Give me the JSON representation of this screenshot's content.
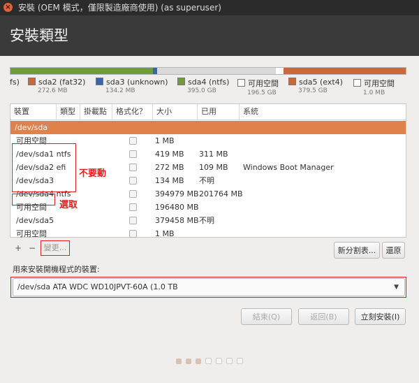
{
  "window": {
    "title": "安裝 (OEM 模式，僅限製造廠商使用) (as superuser)",
    "close_glyph": "×"
  },
  "page": {
    "heading": "安裝類型"
  },
  "partition_bar": {
    "segments": [
      {
        "name": "sda1",
        "color": "#6f9c3a",
        "fraction": 0.36
      },
      {
        "name": "sda3",
        "color": "#3a66a6",
        "fraction": 0.01
      },
      {
        "name": "sda4",
        "color": "#d9d9d9",
        "fraction": 0.3
      },
      {
        "name": "free",
        "color": "#ffffff",
        "fraction": 0.02
      },
      {
        "name": "sda5",
        "color": "#c9683b",
        "fraction": 0.31
      }
    ]
  },
  "legend": [
    {
      "label": "fs)",
      "size": "",
      "color": ""
    },
    {
      "label": "sda2 (fat32)",
      "size": "272.6 MB",
      "color": "#c9683b"
    },
    {
      "label": "sda3 (unknown)",
      "size": "134.2 MB",
      "color": "#3a66a6"
    },
    {
      "label": "sda4 (ntfs)",
      "size": "395.0 GB",
      "color": "#6f9c3a"
    },
    {
      "label": "可用空間",
      "size": "196.5 GB",
      "color": "#ffffff"
    },
    {
      "label": "sda5 (ext4)",
      "size": "379.5 GB",
      "color": "#c9683b"
    },
    {
      "label": "可用空間",
      "size": "1.0 MB",
      "color": "#ffffff"
    }
  ],
  "table": {
    "columns": [
      "裝置",
      "類型",
      "掛載點",
      "格式化？",
      "大小",
      "已用",
      "系統"
    ],
    "group_label": "/dev/sda",
    "rows": [
      {
        "device": "可用空間",
        "size": "1 MB",
        "used": "",
        "system": ""
      },
      {
        "device": "/dev/sda1 ntfs",
        "size": "419 MB",
        "used": "311 MB",
        "system": ""
      },
      {
        "device": "/dev/sda2 efi",
        "size": "272 MB",
        "used": "109 MB",
        "system": "Windows Boot Manager"
      },
      {
        "device": "/dev/sda3",
        "size": "134 MB",
        "used": "不明",
        "system": ""
      },
      {
        "device": "/dev/sda4 ntfs",
        "size": "394979 MB",
        "used": "201764 MB",
        "system": ""
      },
      {
        "device": "可用空間",
        "size": "196480 MB",
        "used": "",
        "system": ""
      },
      {
        "device": "/dev/sda5",
        "size": "379458 MB",
        "used": "不明",
        "system": ""
      },
      {
        "device": "可用空間",
        "size": "1 MB",
        "used": "",
        "system": ""
      }
    ]
  },
  "annotations": {
    "do_not_touch": "不要動",
    "select": "選取"
  },
  "toolbar": {
    "add_label": "+",
    "remove_label": "−",
    "change_label": "變更...",
    "new_table_label": "新分割表...",
    "revert_label": "還原"
  },
  "bootloader": {
    "label": "用來安裝開機程式的裝置:",
    "value": "/dev/sda   ATA WDC WD10JPVT-60A (1.0 TB"
  },
  "footer": {
    "quit_label": "結束(Q)",
    "back_label": "返回(B)",
    "install_label": "立刻安裝(I)"
  },
  "progress": {
    "steps": 7,
    "completed": 3
  }
}
